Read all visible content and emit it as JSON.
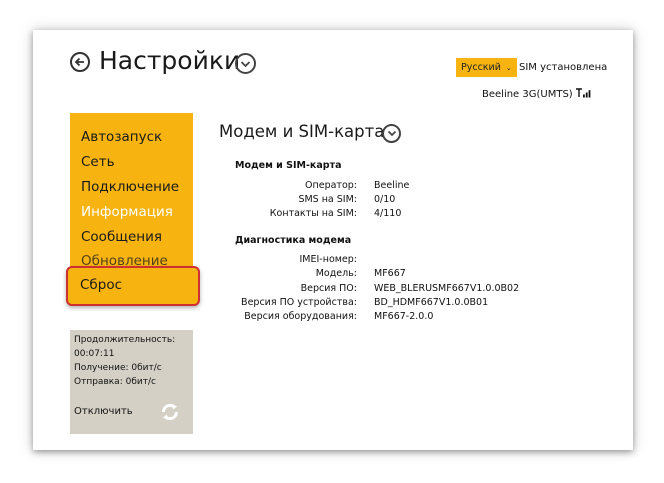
{
  "header": {
    "title": "Настройки",
    "language": "Русский",
    "sim_status": "SIM установлена",
    "network": "Beeline 3G(UMTS)"
  },
  "sidebar": {
    "items": [
      {
        "label": "Автозапуск"
      },
      {
        "label": "Сеть"
      },
      {
        "label": "Подключение"
      },
      {
        "label": "Информация"
      },
      {
        "label": "Сообщения"
      },
      {
        "label": "Обновление"
      },
      {
        "label": "Сброс"
      }
    ]
  },
  "stats": {
    "duration_label": "Продолжительность:",
    "duration_value": "00:07:11",
    "received": "Получение: 0бит/с",
    "sent": "Отправка: 0бит/с",
    "disconnect_label": "Отключить"
  },
  "main": {
    "heading": "Модем и SIM-карта",
    "sim_section": {
      "title": "Модем и SIM-карта",
      "rows": [
        {
          "label": "Оператор:",
          "value": "Beeline"
        },
        {
          "label": "SMS на SIM:",
          "value": "0/10"
        },
        {
          "label": "Контакты на SIM:",
          "value": "4/110"
        }
      ]
    },
    "diag_section": {
      "title": "Диагностика модема",
      "rows": [
        {
          "label": "IMEI-номер:",
          "value": ""
        },
        {
          "label": "Модель:",
          "value": "MF667"
        },
        {
          "label": "Версия ПО:",
          "value": "WEB_BLERUSMF667V1.0.0B02"
        },
        {
          "label": "Версия ПО устройства:",
          "value": "BD_HDMF667V1.0.0B01"
        },
        {
          "label": "Версия оборудования:",
          "value": "MF667-2.0.0"
        }
      ]
    }
  },
  "colors": {
    "accent": "#f7b411",
    "highlight_border": "#cc3030",
    "stats_bg": "#d4d0c5"
  },
  "icons": {
    "back": "back-arrow-circle-icon",
    "dropdown": "chevron-down-circle-icon",
    "signal": "signal-bars-icon",
    "refresh": "refresh-icon"
  }
}
